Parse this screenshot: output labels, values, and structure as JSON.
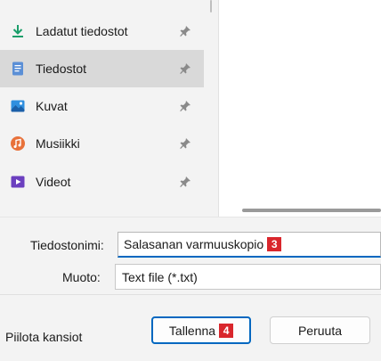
{
  "sidebar": {
    "items": [
      {
        "label": "Ladatut tiedostot",
        "icon": "download-icon",
        "selected": false,
        "pinned": true
      },
      {
        "label": "Tiedostot",
        "icon": "documents-icon",
        "selected": true,
        "pinned": true
      },
      {
        "label": "Kuvat",
        "icon": "pictures-icon",
        "selected": false,
        "pinned": true
      },
      {
        "label": "Musiikki",
        "icon": "music-icon",
        "selected": false,
        "pinned": true
      },
      {
        "label": "Videot",
        "icon": "videos-icon",
        "selected": false,
        "pinned": true
      }
    ]
  },
  "form": {
    "filename_label": "Tiedostonimi:",
    "filename_value": "Salasanan varmuuskopio",
    "filetype_label": "Muoto:",
    "filetype_value": "Text file (*.txt)"
  },
  "footer": {
    "hide_folders_label": "Piilota kansiot",
    "save_label": "Tallenna",
    "cancel_label": "Peruuta"
  },
  "annotations": {
    "filename_badge": "3",
    "save_badge": "4"
  },
  "colors": {
    "accent": "#0067c0",
    "badge": "#d9262c",
    "selected_row": "#d9d9d9",
    "panel_bg": "#f3f3f3"
  }
}
